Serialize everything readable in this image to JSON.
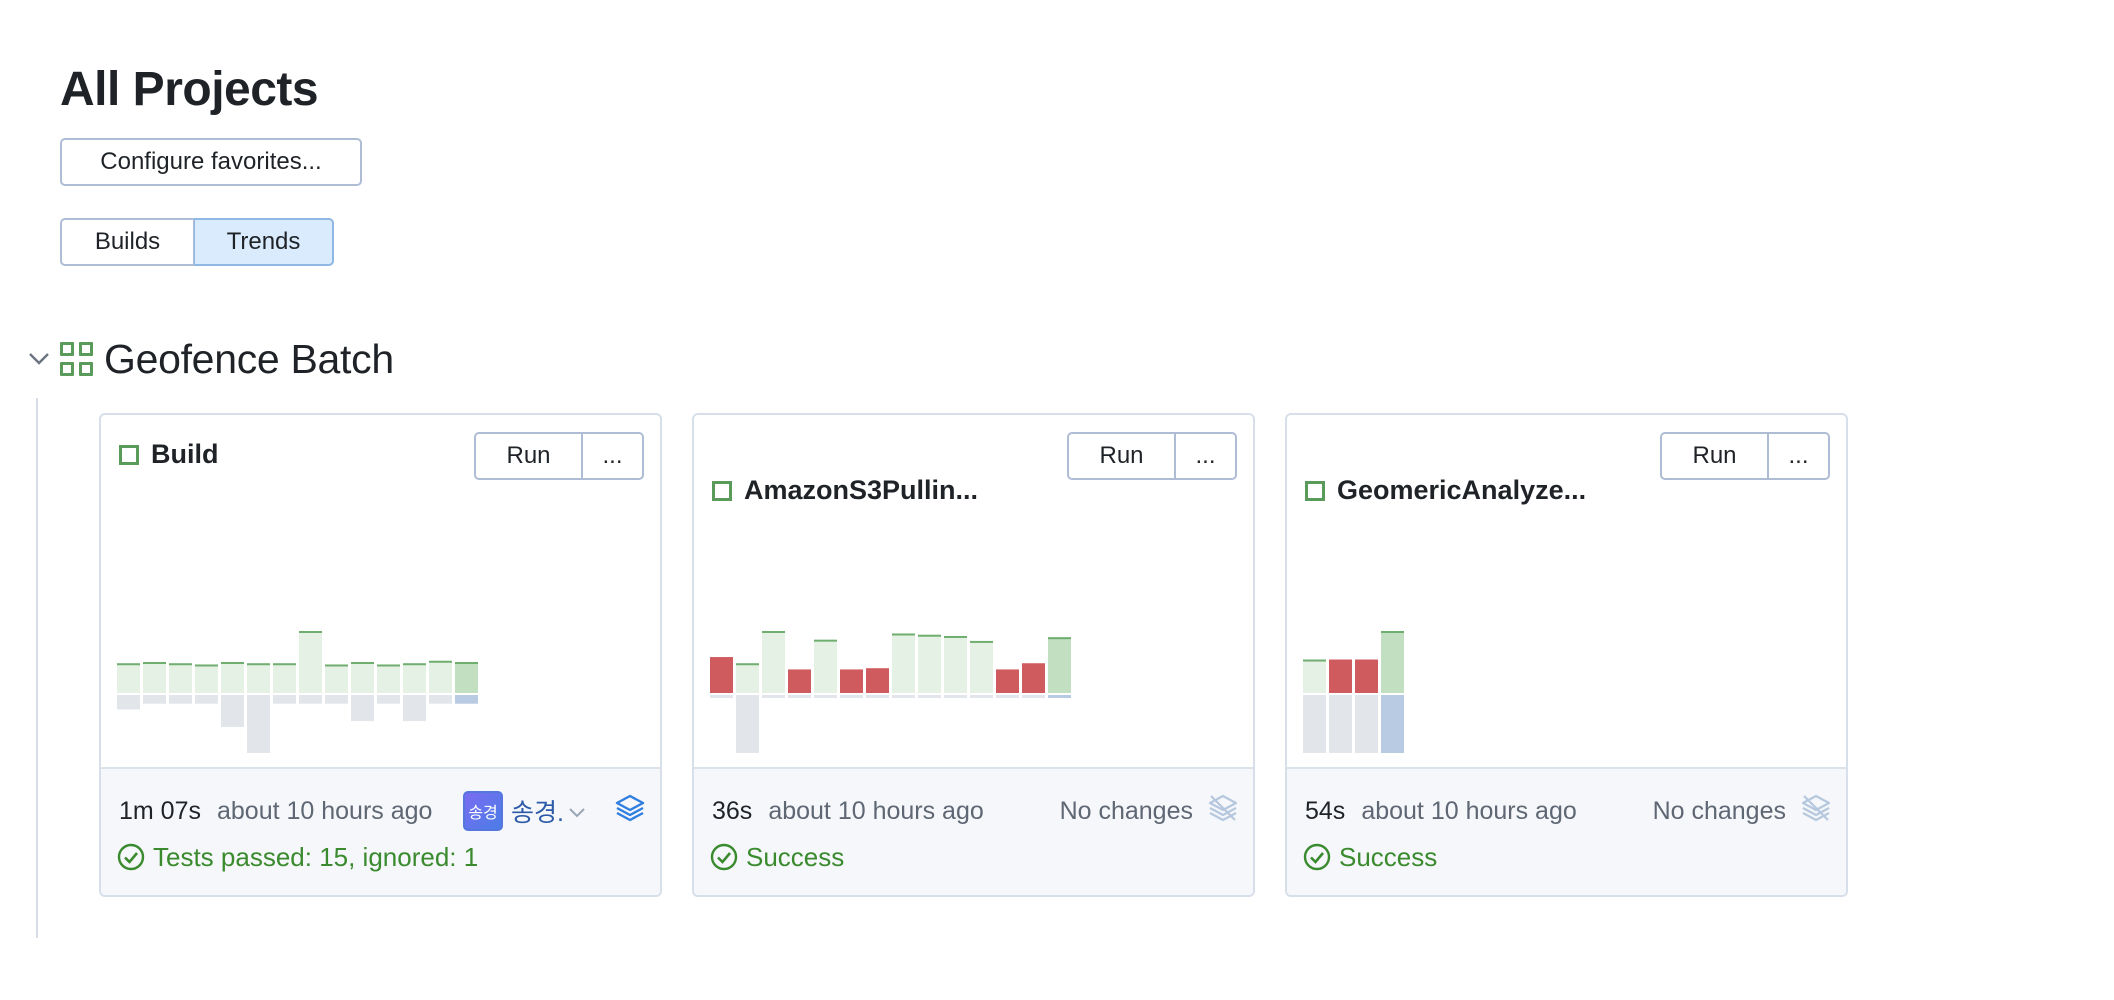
{
  "page": {
    "title": "All Projects",
    "configure_label": "Configure favorites...",
    "view_toggle": {
      "builds": "Builds",
      "trends": "Trends",
      "selected": "Trends"
    }
  },
  "group": {
    "title": "Geofence Batch",
    "expanded": true
  },
  "colors": {
    "success": "#3a8a2e",
    "failure_bar": "#cf5b5f",
    "success_bar": "#e6f1e6",
    "success_bar_current": "#c2dfc2",
    "duration_bar": "#e2e6eb",
    "duration_bar_current": "#b9cbe3",
    "toggle_selected": "#d9ebfd",
    "link": "#2a5aa8"
  },
  "cards": [
    {
      "name": "Build",
      "run_label": "Run",
      "more_label": "...",
      "duration": "1m 07s",
      "time_ago": "about 10 hours ago",
      "user_avatar": "송경",
      "user_name": "송경.",
      "changes_icon": "layers-icon",
      "status_text": "Tests passed: 15, ignored: 1",
      "status": "success",
      "history": {
        "results": [
          "success",
          "success",
          "success",
          "success",
          "success",
          "success",
          "success",
          "success",
          "success",
          "success",
          "success",
          "success",
          "success",
          "success"
        ],
        "value_upper": [
          0.48,
          0.5,
          0.48,
          0.46,
          0.5,
          0.48,
          0.48,
          1.0,
          0.46,
          0.5,
          0.46,
          0.48,
          0.52,
          0.5
        ],
        "value_lower": [
          0.25,
          0.15,
          0.15,
          0.15,
          0.55,
          1.0,
          0.15,
          0.15,
          0.15,
          0.45,
          0.15,
          0.45,
          0.15,
          0.15
        ]
      }
    },
    {
      "name": "AmazonS3Pullin...",
      "run_label": "Run",
      "more_label": "...",
      "duration": "36s",
      "time_ago": "about 10 hours ago",
      "no_changes": "No changes",
      "changes_icon": "layers-off-icon",
      "status_text": "Success",
      "status": "success",
      "history": {
        "results": [
          "failure",
          "success",
          "success",
          "failure",
          "success",
          "failure",
          "failure",
          "success",
          "success",
          "success",
          "success",
          "failure",
          "failure",
          "success"
        ],
        "value_upper": [
          0.58,
          0.48,
          1.0,
          0.38,
          0.86,
          0.38,
          0.4,
          0.96,
          0.94,
          0.92,
          0.84,
          0.38,
          0.48,
          0.9
        ],
        "value_lower": [
          0.03,
          1.0,
          0.03,
          0.03,
          0.03,
          0.03,
          0.03,
          0.03,
          0.03,
          0.03,
          0.03,
          0.03,
          0.03,
          0.05
        ]
      }
    },
    {
      "name": "GeomericAnalyze...",
      "run_label": "Run",
      "more_label": "...",
      "duration": "54s",
      "time_ago": "about 10 hours ago",
      "no_changes": "No changes",
      "changes_icon": "layers-off-icon",
      "status_text": "Success",
      "status": "success",
      "history": {
        "results": [
          "success",
          "failure",
          "failure",
          "success"
        ],
        "value_upper": [
          0.54,
          0.54,
          0.54,
          1.0
        ],
        "value_lower": [
          1.0,
          1.0,
          1.0,
          1.0
        ]
      }
    }
  ]
}
